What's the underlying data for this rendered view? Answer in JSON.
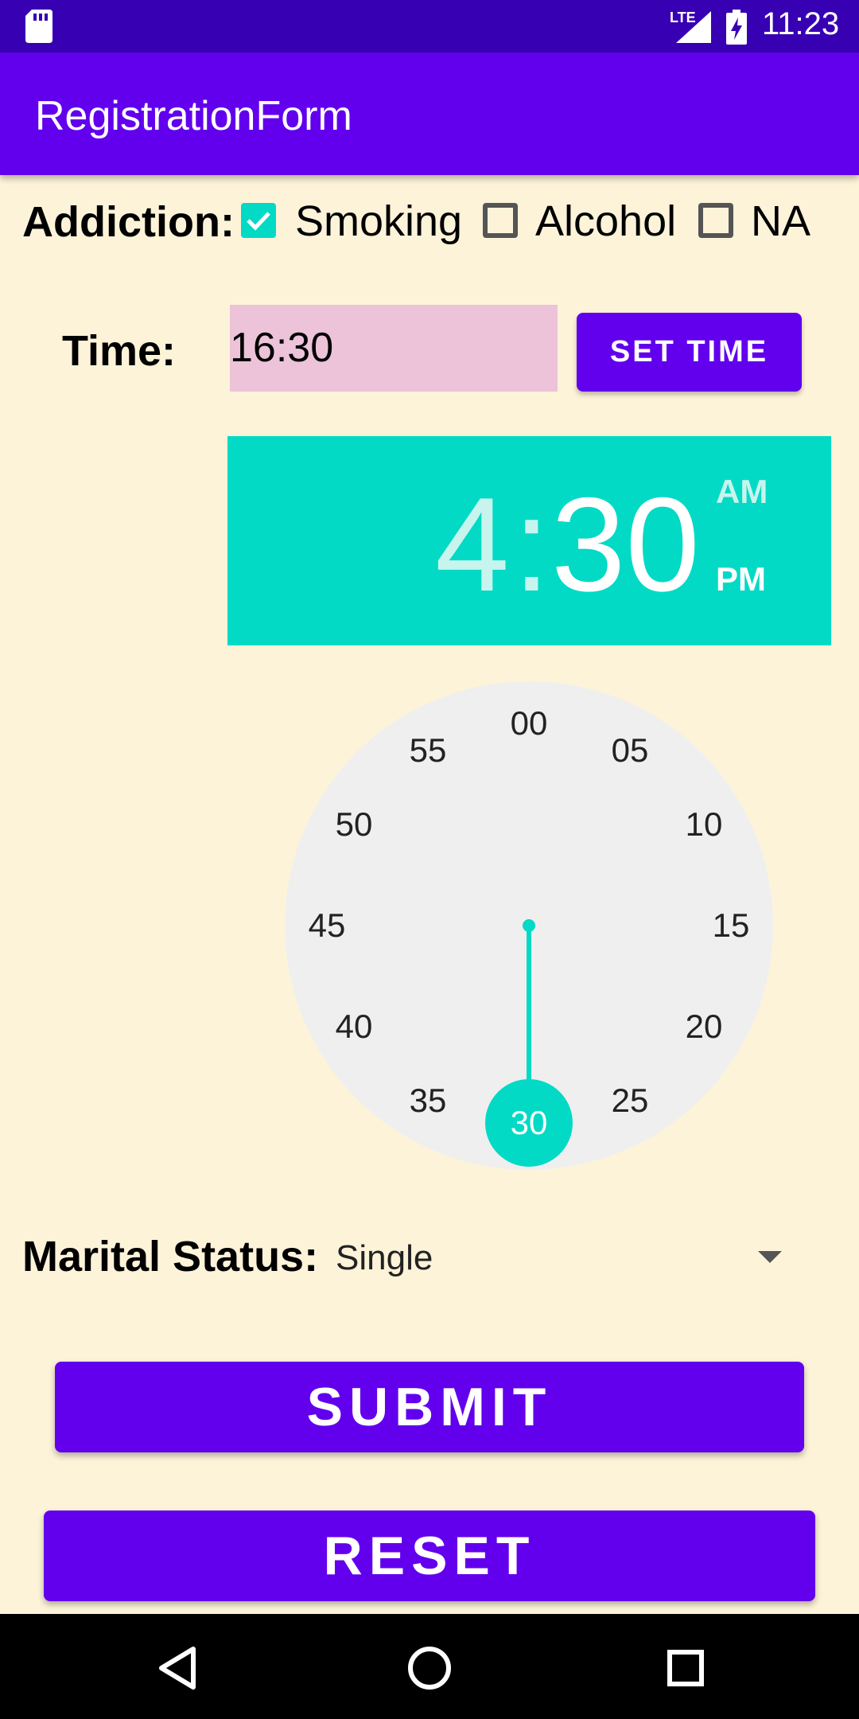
{
  "status_bar": {
    "network": "LTE",
    "time": "11:23"
  },
  "app_bar": {
    "title": "RegistrationForm"
  },
  "addiction": {
    "label": "Addiction:",
    "options": [
      {
        "label": "Smoking",
        "checked": true
      },
      {
        "label": "Alcohol",
        "checked": false
      },
      {
        "label": "NA",
        "checked": false
      }
    ]
  },
  "time": {
    "label": "Time:",
    "value": "16:30",
    "button_label": "SET TIME"
  },
  "picker": {
    "hour": "4",
    "separator": ":",
    "minute": "30",
    "am": "AM",
    "pm": "PM",
    "selected_period": "PM",
    "ticks": [
      "00",
      "05",
      "10",
      "15",
      "20",
      "25",
      "30",
      "35",
      "40",
      "45",
      "50",
      "55"
    ],
    "selected_tick": "30"
  },
  "marital": {
    "label": "Marital Status:",
    "value": "Single"
  },
  "buttons": {
    "submit": "SUBMIT",
    "reset": "RESET"
  },
  "colors": {
    "primary": "#6200ee",
    "status_bar": "#3700b3",
    "accent": "#03dac5",
    "background": "#fdf3d9",
    "time_field": "#ecc3d8"
  },
  "icons": [
    "sd-card-icon",
    "signal-icon",
    "battery-charging-icon",
    "dropdown-arrow-icon",
    "nav-back-icon",
    "nav-home-icon",
    "nav-recents-icon"
  ]
}
